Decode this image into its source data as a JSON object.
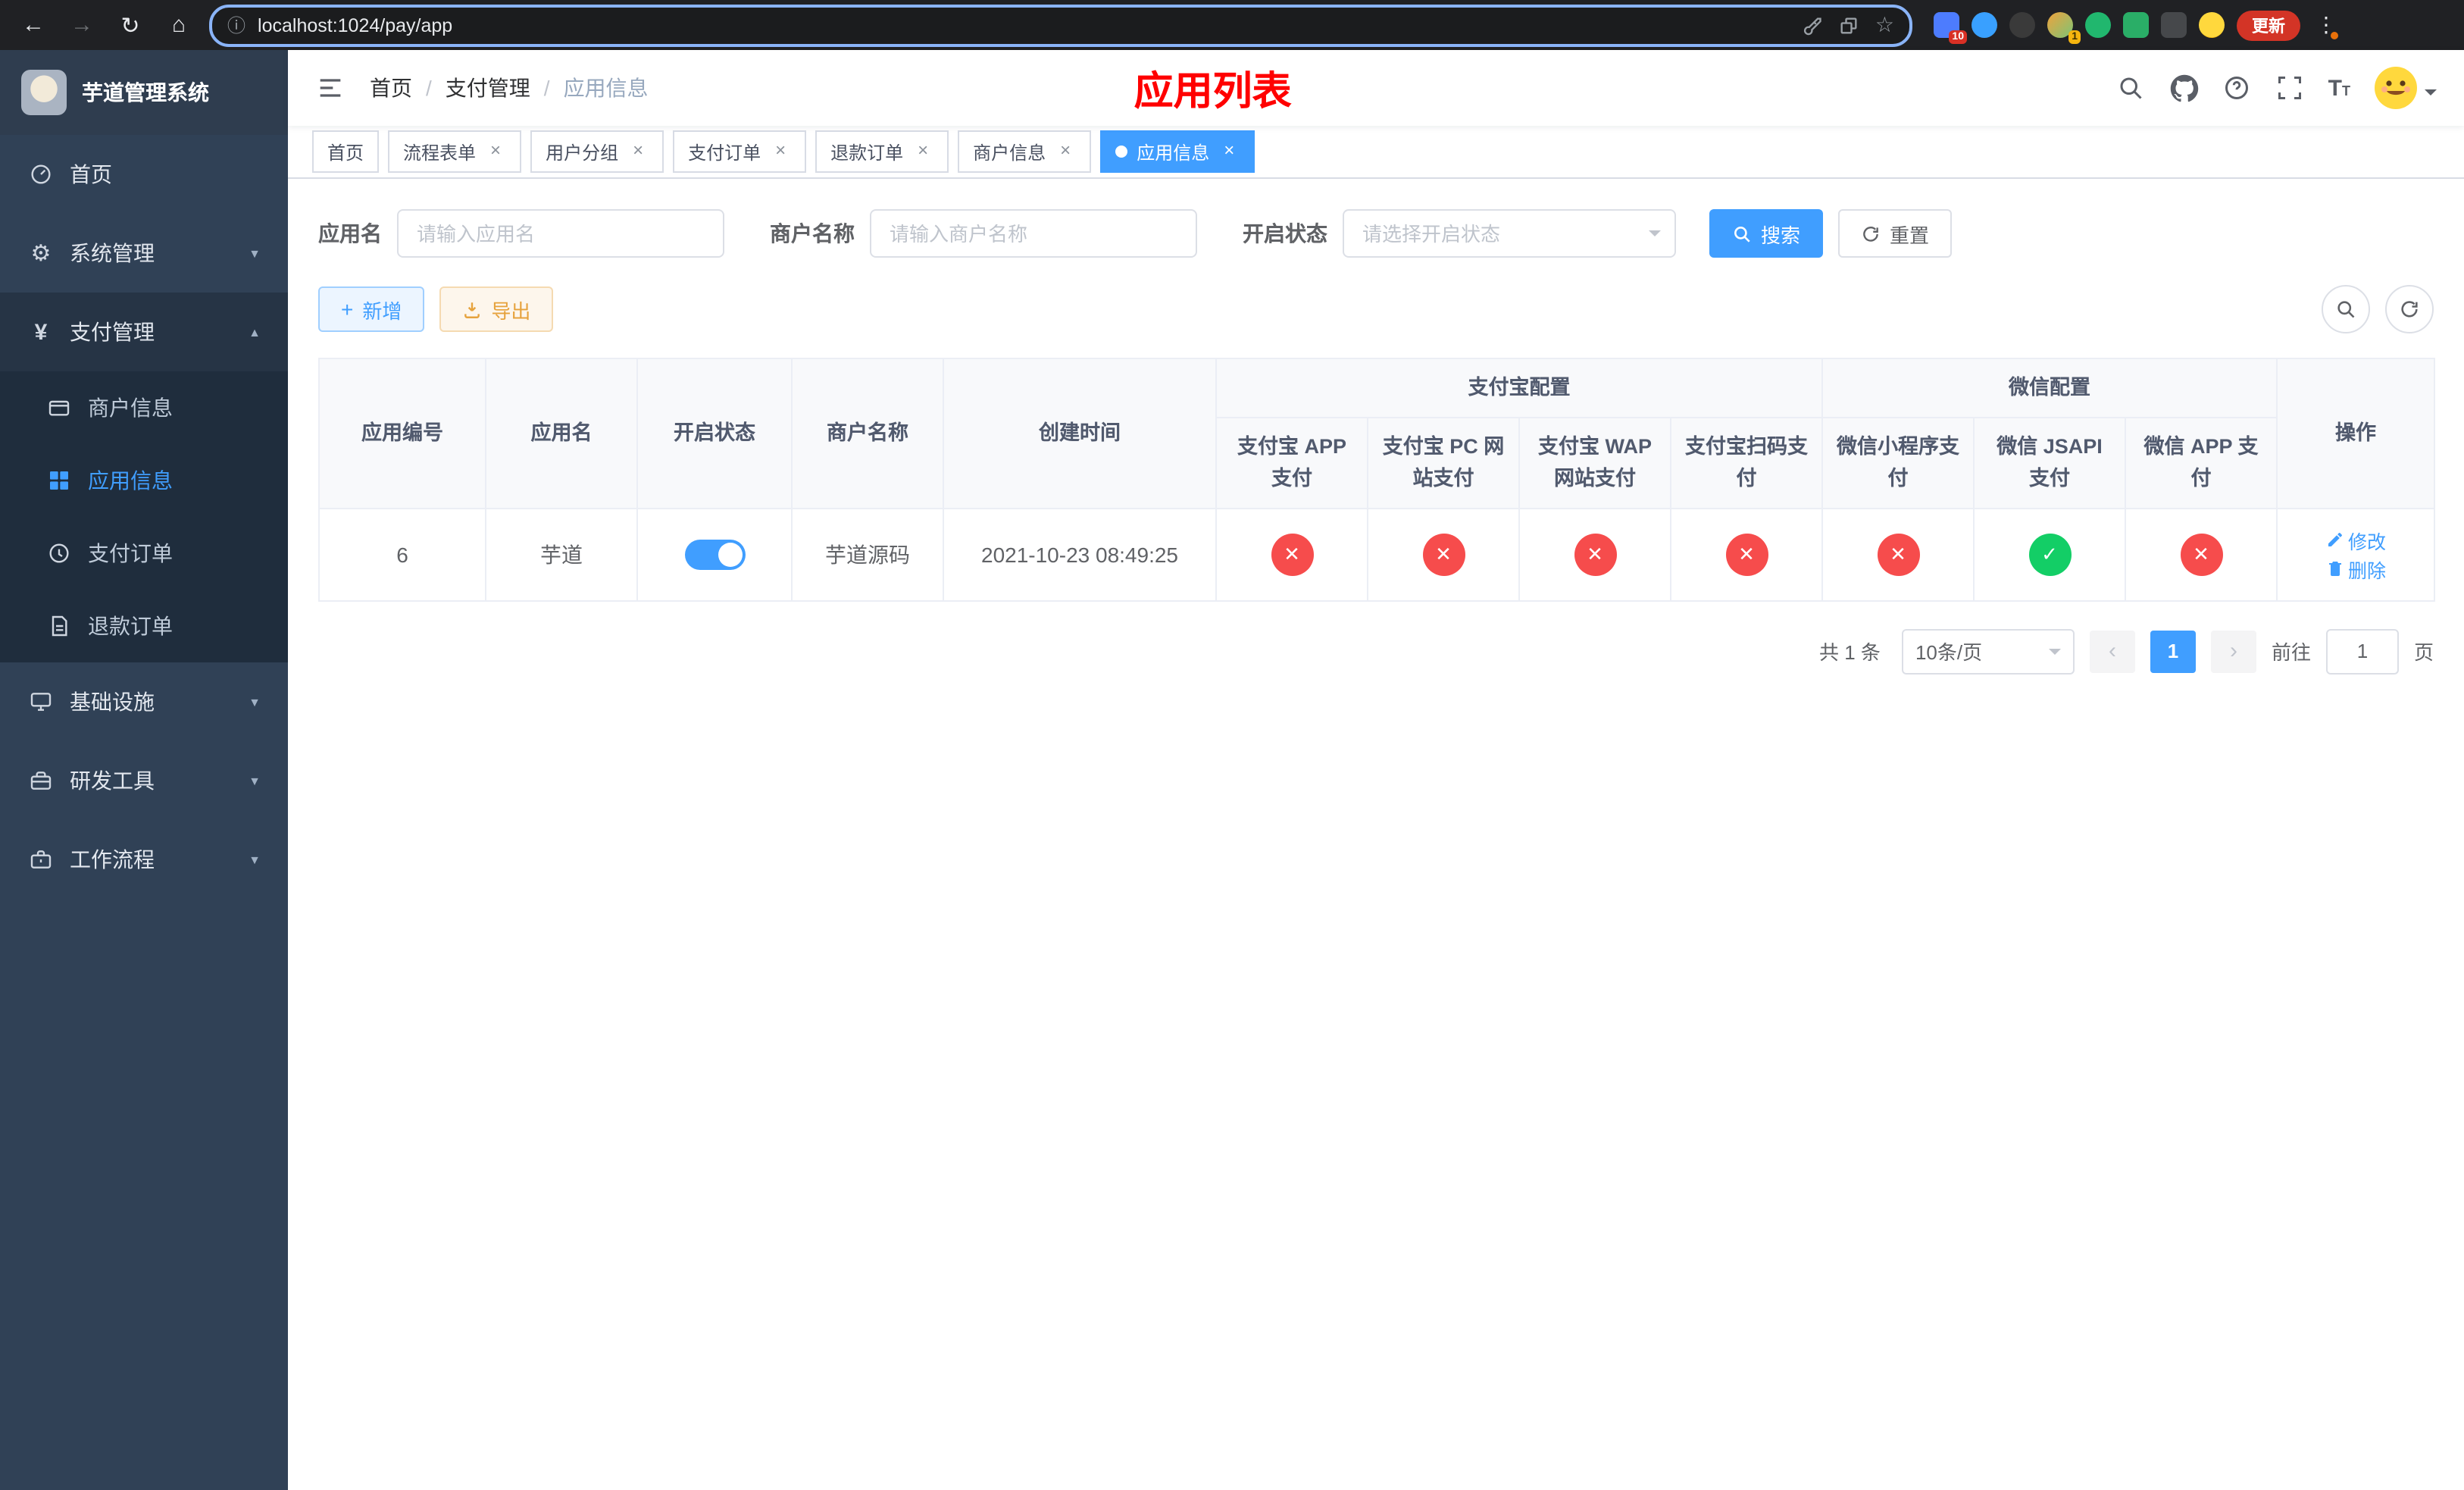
{
  "colors": {
    "primary": "#409eff",
    "danger_circle": "#f64c4c",
    "success_circle": "#13ce66",
    "page_title_red": "#ff0000",
    "sidebar_bg": "#304156",
    "submenu_bg": "#1f2d3d"
  },
  "icons": {
    "back": "←",
    "forward": "→",
    "reload": "↻",
    "home": "⌂",
    "info": "ⓘ",
    "star": "☆",
    "kebab": "⋮",
    "plus": "+",
    "tab_close": "×",
    "cross": "✕",
    "check": "✓",
    "caret_down": "▼",
    "caret_up": "▲",
    "prev": "‹",
    "next": "›"
  },
  "browser": {
    "url": "localhost:1024/pay/app",
    "update_label": "更新",
    "ext_badge_1": "10",
    "ext_badge_2": "1"
  },
  "sidebar": {
    "title": "芋道管理系统",
    "items": [
      {
        "label": "首页"
      },
      {
        "label": "系统管理"
      },
      {
        "label": "支付管理"
      },
      {
        "label": "基础设施"
      },
      {
        "label": "研发工具"
      },
      {
        "label": "工作流程"
      }
    ],
    "payment_children": [
      {
        "label": "商户信息"
      },
      {
        "label": "应用信息"
      },
      {
        "label": "支付订单"
      },
      {
        "label": "退款订单"
      }
    ]
  },
  "navbar": {
    "breadcrumb": [
      "首页",
      "支付管理",
      "应用信息"
    ],
    "separator": "/",
    "title": "应用列表"
  },
  "tabs": [
    {
      "label": "首页"
    },
    {
      "label": "流程表单"
    },
    {
      "label": "用户分组"
    },
    {
      "label": "支付订单"
    },
    {
      "label": "退款订单"
    },
    {
      "label": "商户信息"
    },
    {
      "label": "应用信息"
    }
  ],
  "filters": {
    "app_name_label": "应用名",
    "app_name_placeholder": "请输入应用名",
    "merchant_label": "商户名称",
    "merchant_placeholder": "请输入商户名称",
    "status_label": "开启状态",
    "status_placeholder": "请选择开启状态",
    "search_button": "搜索",
    "reset_button": "重置"
  },
  "toolbar": {
    "add_label": "新增",
    "export_label": "导出"
  },
  "table": {
    "columns": [
      "应用编号",
      "应用名",
      "开启状态",
      "商户名称",
      "创建时间"
    ],
    "groups": [
      {
        "label": "支付宝配置",
        "children": [
          "支付宝 APP 支付",
          "支付宝 PC 网站支付",
          "支付宝 WAP 网站支付",
          "支付宝扫码支付"
        ]
      },
      {
        "label": "微信配置",
        "children": [
          "微信小程序支付",
          "微信 JSAPI 支付",
          "微信 APP 支付"
        ]
      }
    ],
    "ops_column": "操作",
    "row": {
      "id": "6",
      "name": "芋道",
      "enabled": true,
      "merchant": "芋道源码",
      "created_at": "2021-10-23 08:49:25",
      "configs": {
        "alipay_app": false,
        "alipay_pc": false,
        "alipay_wap": false,
        "alipay_qr": false,
        "wx_lite": false,
        "wx_jsapi": true,
        "wx_app": false
      },
      "edit_label": "修改",
      "delete_label": "删除"
    }
  },
  "pagination": {
    "total_text": "共 1 条",
    "page_size": "10条/页",
    "current_page": "1",
    "goto_label": "前往",
    "goto_value": "1",
    "goto_suffix": "页"
  }
}
